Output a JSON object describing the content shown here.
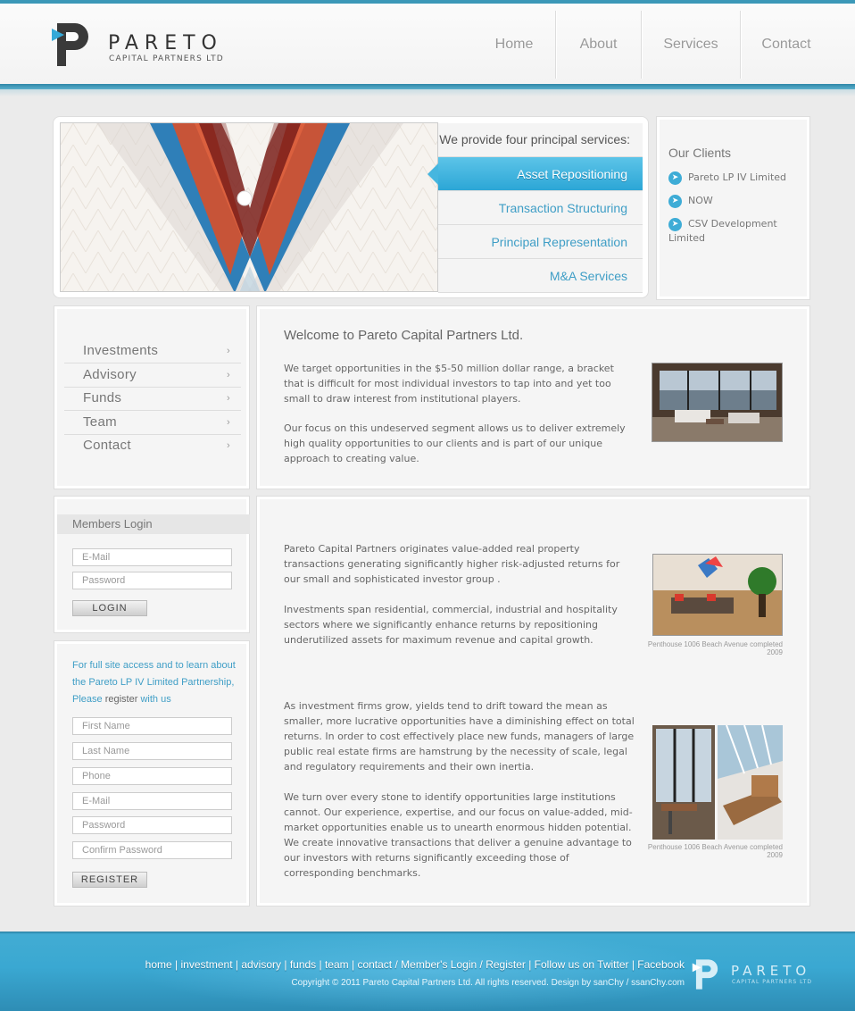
{
  "header": {
    "brand": "PARETO",
    "brand_sub": "CAPITAL PARTNERS LTD",
    "nav": [
      "Home",
      "About",
      "Services",
      "Contact"
    ]
  },
  "hero": {
    "services_heading": "We provide four principal services:",
    "services": [
      "Asset Repositioning",
      "Transaction Structuring",
      "Principal Representation",
      "M&A Services"
    ],
    "active_service": "Asset Repositioning"
  },
  "clients": {
    "title": "Our Clients",
    "items": [
      "Pareto LP IV Limited",
      "NOW",
      "CSV Development Limited"
    ]
  },
  "sidemenu": {
    "items": [
      "Investments",
      "Advisory",
      "Funds",
      "Team",
      "Contact"
    ]
  },
  "welcome": {
    "title": "Welcome to Pareto Capital Partners Ltd.",
    "p1": "We target opportunities in the $5-50 million dollar range, a bracket that is difficult for most individual investors to tap into and yet too small to draw interest from institutional players.",
    "p2": "Our focus on this undeserved segment allows us to deliver extremely high quality opportunities to our clients and is part of our unique approach to creating value."
  },
  "login": {
    "title": "Members Login",
    "email_placeholder": "E-Mail",
    "password_placeholder": "Password",
    "button": "LOGIN"
  },
  "register": {
    "msg_a": "For full site access and to learn about the Pareto LP IV Limited Partnership, Please",
    "msg_b": "register",
    "msg_c": "with us",
    "fields": [
      "First Name",
      "Last Name",
      "Phone",
      "E-Mail",
      "Password",
      "Confirm Password"
    ],
    "button": "REGISTER"
  },
  "content": {
    "p1": "Pareto Capital Partners originates value-added real property transactions generating significantly higher risk-adjusted returns for our small and sophisticated investor group .",
    "p2": "Investments span residential, commercial, industrial and hospitality sectors where we significantly enhance returns by repositioning underutilized assets for maximum revenue and capital growth.",
    "p3": "As investment firms grow, yields tend to drift toward the mean as smaller, more lucrative opportunities have a diminishing effect on total returns.  In order to cost effectively place new funds, managers of large public real estate firms are hamstrung by the necessity of scale, legal and regulatory requirements and their own inertia.",
    "p4": "We turn over every stone to identify opportunities large institutions cannot.  Our experience, expertise, and our focus on value-added, mid-market opportunities enable us to unearth enormous hidden potential.  We create innovative transactions that deliver a genuine advantage to our investors with returns significantly exceeding those of corresponding benchmarks.",
    "caption1": "Penthouse 1006 Beach Avenue completed 2009",
    "caption2": "Penthouse 1006 Beach Avenue completed 2009"
  },
  "footer": {
    "links": [
      "home",
      "investment",
      "advisory",
      "funds",
      "team",
      "contact",
      "Member's Login",
      "Register",
      "Follow us on Twitter",
      "Facebook"
    ],
    "copyright": "Copyright © 2011 Pareto Capital Partners Ltd. All rights reserved. Design by sanChy / ssanChy.com",
    "brand": "PARETO",
    "brand_sub": "CAPITAL PARTNERS LTD"
  },
  "colors": {
    "accent": "#3eacd6",
    "link": "#3f9ec6",
    "footer": "#3aa8d2"
  }
}
